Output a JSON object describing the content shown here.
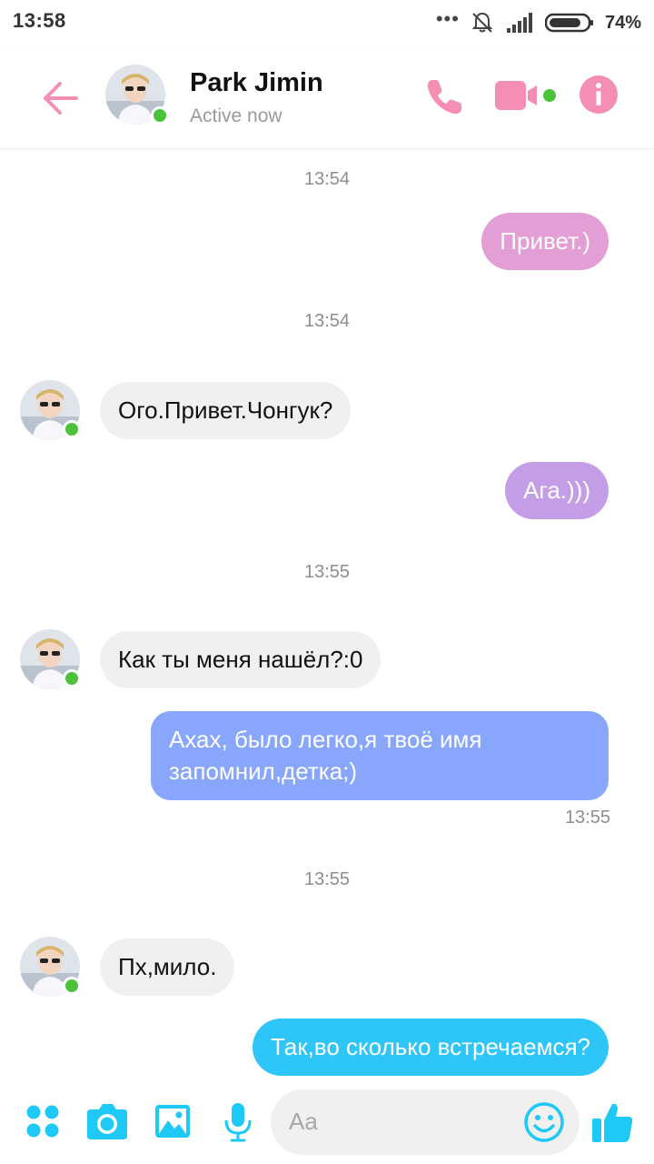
{
  "status_bar": {
    "time": "13:58",
    "dots": "•••",
    "battery_percent": "74%"
  },
  "header": {
    "contact_name": "Park Jimin",
    "contact_status": "Active now"
  },
  "colors": {
    "accent_pink": "#f58eb4",
    "online_green": "#4cc23a",
    "messenger_blue": "#1ec8f7",
    "incoming_bubble": "#f1f0f0"
  },
  "messages": [
    {
      "type": "timestamp",
      "text": "13:54"
    },
    {
      "type": "outgoing",
      "text": "Привет.)",
      "color": "#e39ed5"
    },
    {
      "type": "timestamp",
      "text": "13:54"
    },
    {
      "type": "incoming",
      "text": "Ого.Привет.Чонгук?"
    },
    {
      "type": "outgoing",
      "text": "Ага.)))",
      "color": "#c39ee6"
    },
    {
      "type": "timestamp",
      "text": "13:55"
    },
    {
      "type": "incoming",
      "text": "Как ты меня нашёл?:0"
    },
    {
      "type": "outgoing",
      "text": "Ахах, было легко,я твоё имя\nзапомнил,детка;)",
      "color": "#88a7fc",
      "sent_time": "13:55"
    },
    {
      "type": "timestamp",
      "text": "13:55"
    },
    {
      "type": "incoming",
      "text": "Пх,мило."
    },
    {
      "type": "outgoing",
      "text": "Так,во сколько встречаемся?",
      "color": "#2ec6f9"
    }
  ],
  "composer": {
    "placeholder": "Aa",
    "icons": [
      "more-apps-icon",
      "camera-icon",
      "gallery-icon",
      "microphone-icon",
      "emoji-icon",
      "thumbs-up-icon"
    ]
  }
}
